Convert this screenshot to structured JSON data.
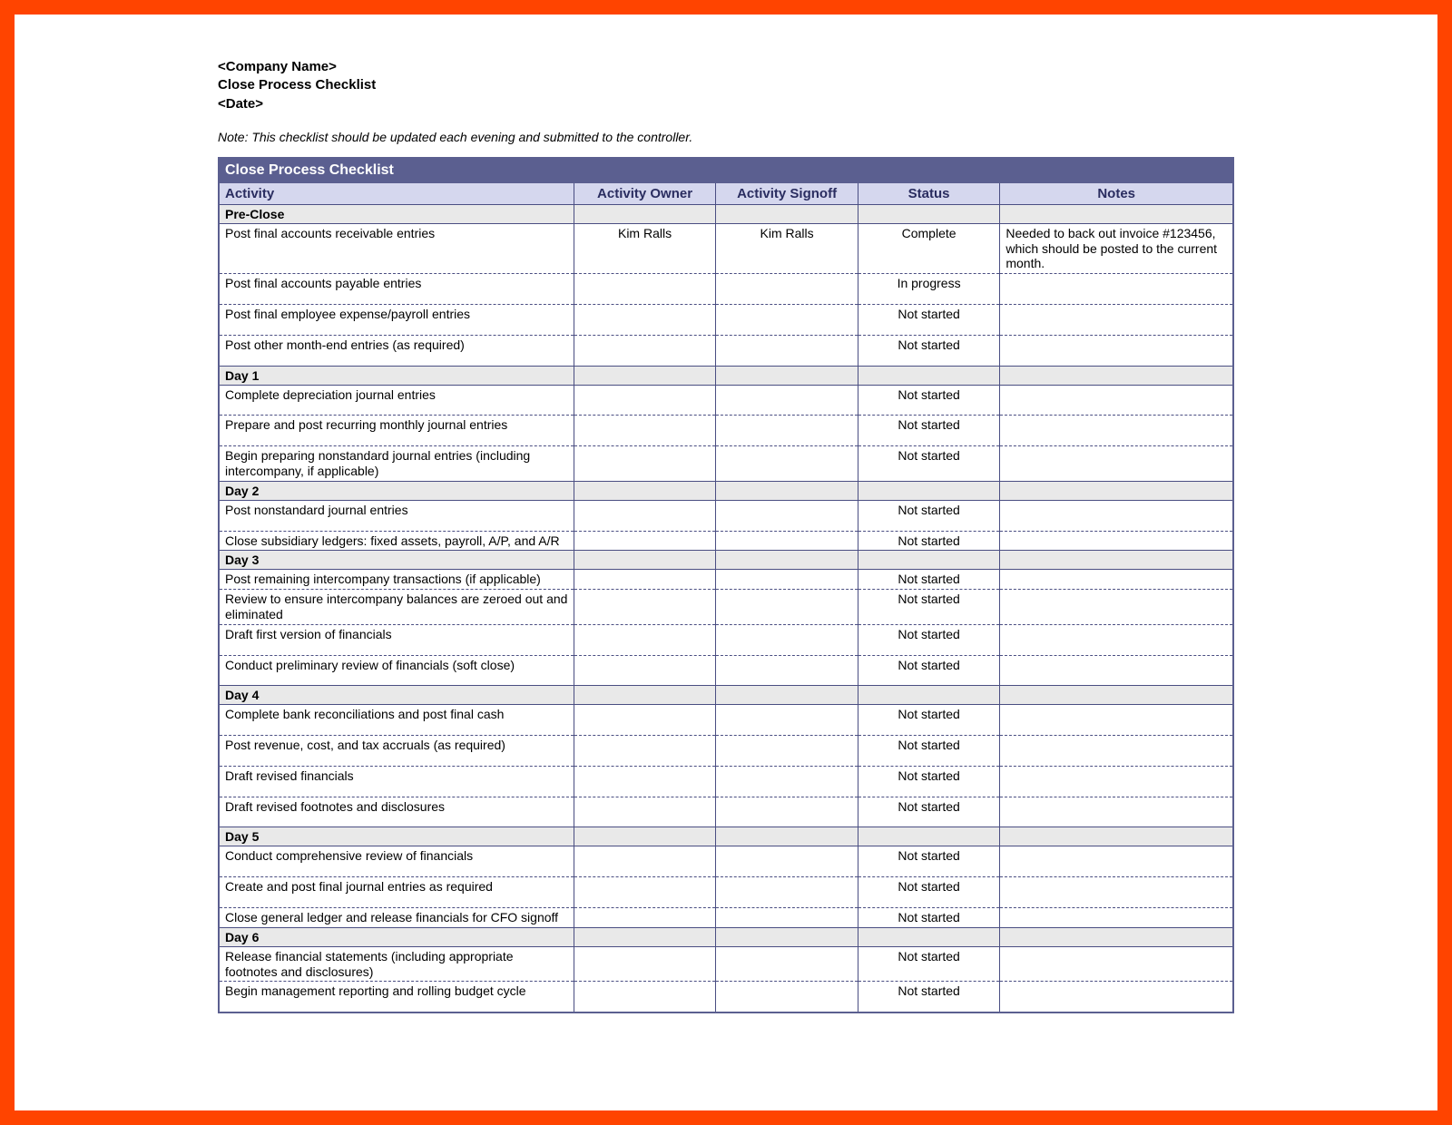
{
  "header": {
    "company": "<Company Name>",
    "title": "Close Process Checklist",
    "date": "<Date>"
  },
  "note": "Note: This checklist should be updated each evening and submitted to the controller.",
  "tableTitle": "Close Process Checklist",
  "columns": {
    "activity": "Activity",
    "owner": "Activity Owner",
    "signoff": "Activity Signoff",
    "status": "Status",
    "notes": "Notes"
  },
  "rows": [
    {
      "type": "section",
      "label": "Pre-Close"
    },
    {
      "type": "data",
      "activity": "Post final accounts receivable entries",
      "owner": "Kim Ralls",
      "signoff": "Kim Ralls",
      "status": "Complete",
      "notes": "Needed to back out invoice #123456, which should be posted to the current month.",
      "tight": true
    },
    {
      "type": "data",
      "activity": "Post final accounts payable entries",
      "owner": "",
      "signoff": "",
      "status": "In progress",
      "notes": ""
    },
    {
      "type": "data",
      "activity": "Post final employee expense/payroll entries",
      "owner": "",
      "signoff": "",
      "status": "Not started",
      "notes": ""
    },
    {
      "type": "data",
      "activity": "Post other month-end entries (as required)",
      "owner": "",
      "signoff": "",
      "status": "Not started",
      "notes": ""
    },
    {
      "type": "section",
      "label": "Day 1"
    },
    {
      "type": "data",
      "activity": "Complete depreciation journal entries",
      "owner": "",
      "signoff": "",
      "status": "Not started",
      "notes": ""
    },
    {
      "type": "data",
      "activity": "Prepare and post recurring monthly journal entries",
      "owner": "",
      "signoff": "",
      "status": "Not started",
      "notes": ""
    },
    {
      "type": "data",
      "activity": "Begin preparing nonstandard journal entries (including intercompany, if applicable)",
      "owner": "",
      "signoff": "",
      "status": "Not started",
      "notes": "",
      "tight": true
    },
    {
      "type": "section",
      "label": "Day 2"
    },
    {
      "type": "data",
      "activity": "Post nonstandard journal entries",
      "owner": "",
      "signoff": "",
      "status": "Not started",
      "notes": ""
    },
    {
      "type": "data",
      "activity": "Close subsidiary ledgers: fixed assets, payroll, A/P, and A/R",
      "owner": "",
      "signoff": "",
      "status": "Not started",
      "notes": "",
      "tight": true
    },
    {
      "type": "section",
      "label": "Day 3"
    },
    {
      "type": "data",
      "activity": "Post remaining intercompany transactions (if applicable)",
      "owner": "",
      "signoff": "",
      "status": "Not started",
      "notes": "",
      "tight": true
    },
    {
      "type": "data",
      "activity": "Review to ensure intercompany balances are zeroed out and eliminated",
      "owner": "",
      "signoff": "",
      "status": "Not started",
      "notes": "",
      "tight": true
    },
    {
      "type": "data",
      "activity": "Draft first version of financials",
      "owner": "",
      "signoff": "",
      "status": "Not started",
      "notes": ""
    },
    {
      "type": "data",
      "activity": "Conduct preliminary review of financials (soft close)",
      "owner": "",
      "signoff": "",
      "status": "Not started",
      "notes": ""
    },
    {
      "type": "section",
      "label": "Day 4"
    },
    {
      "type": "data",
      "activity": "Complete bank reconciliations and post final cash",
      "owner": "",
      "signoff": "",
      "status": "Not started",
      "notes": ""
    },
    {
      "type": "data",
      "activity": "Post revenue, cost, and tax accruals (as required)",
      "owner": "",
      "signoff": "",
      "status": "Not started",
      "notes": ""
    },
    {
      "type": "data",
      "activity": "Draft revised financials",
      "owner": "",
      "signoff": "",
      "status": "Not started",
      "notes": ""
    },
    {
      "type": "data",
      "activity": "Draft revised footnotes and disclosures",
      "owner": "",
      "signoff": "",
      "status": "Not started",
      "notes": ""
    },
    {
      "type": "section",
      "label": "Day 5"
    },
    {
      "type": "data",
      "activity": "Conduct comprehensive review of financials",
      "owner": "",
      "signoff": "",
      "status": "Not started",
      "notes": ""
    },
    {
      "type": "data",
      "activity": "Create and post final journal entries as required",
      "owner": "",
      "signoff": "",
      "status": "Not started",
      "notes": ""
    },
    {
      "type": "data",
      "activity": "Close general ledger and release financials for CFO signoff",
      "owner": "",
      "signoff": "",
      "status": "Not started",
      "notes": "",
      "tight": true
    },
    {
      "type": "section",
      "label": "Day 6"
    },
    {
      "type": "data",
      "activity": "Release financial statements (including appropriate footnotes and disclosures)",
      "owner": "",
      "signoff": "",
      "status": "Not started",
      "notes": "",
      "tight": true
    },
    {
      "type": "data",
      "activity": "Begin management reporting and rolling budget cycle",
      "owner": "",
      "signoff": "",
      "status": "Not started",
      "notes": ""
    }
  ]
}
